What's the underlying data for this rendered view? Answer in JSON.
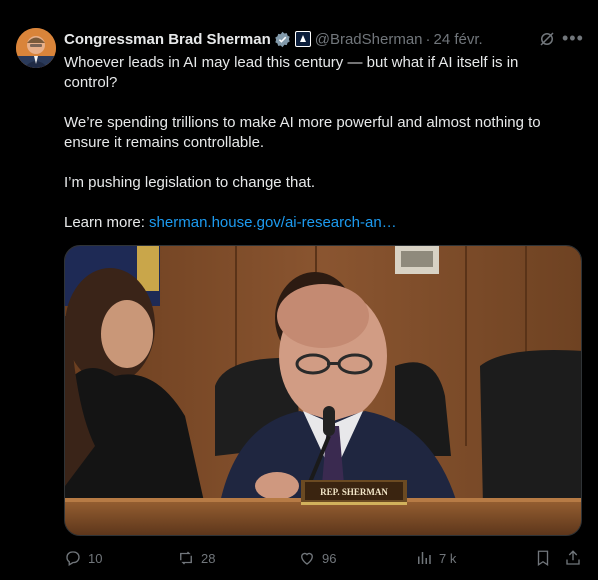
{
  "author": {
    "display_name": "Congressman Brad Sherman",
    "handle": "@BradSherman",
    "date": "24 févr.",
    "verified_icon": "verified-badge-icon",
    "affiliation_icon": "government-affiliation-icon"
  },
  "tweet": {
    "paragraph1": "Whoever leads in AI may lead this century — but what if AI itself is in control?",
    "paragraph2": "We’re spending trillions to make AI more powerful and almost nothing to ensure it remains controllable.",
    "paragraph3": "I’m pushing legislation to change that.",
    "learn_more_prefix": "Learn more: ",
    "link_text": "sherman.house.gov/ai-research-an…"
  },
  "media": {
    "nameplate": "REP. SHERMAN"
  },
  "actions": {
    "replies": "10",
    "reposts": "28",
    "likes": "96",
    "views": "7 k"
  },
  "colors": {
    "background": "#000000",
    "text": "#e7e9ea",
    "secondary": "#71767b",
    "link": "#1d9bf0"
  }
}
